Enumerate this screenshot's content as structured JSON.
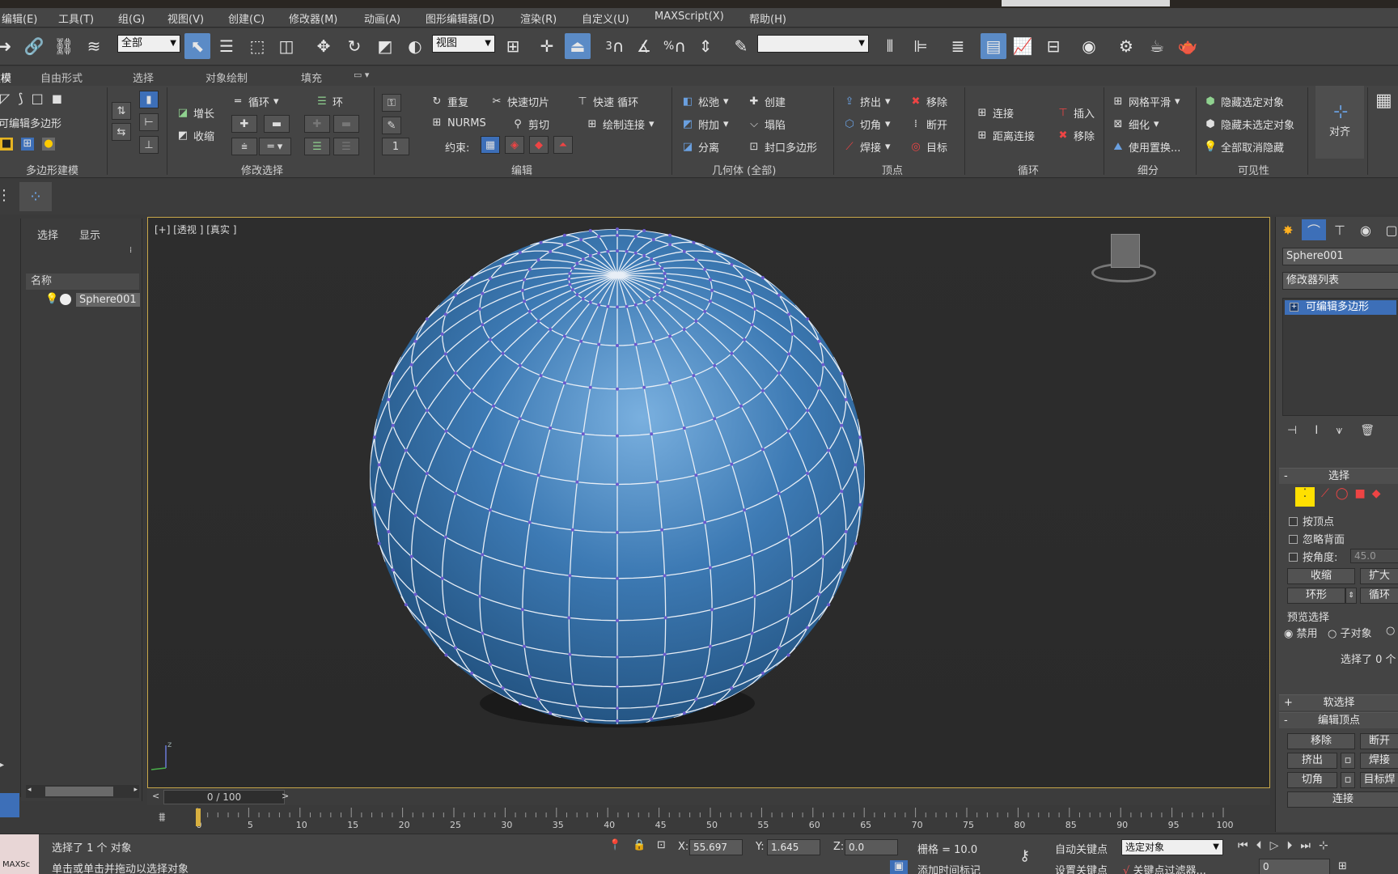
{
  "menu": [
    "编辑(E)",
    "工具(T)",
    "组(G)",
    "视图(V)",
    "创建(C)",
    "修改器(M)",
    "动画(A)",
    "图形编辑器(D)",
    "渲染(R)",
    "自定义(U)",
    "MAXScript(X)",
    "帮助(H)"
  ],
  "toolbar": {
    "filter_value": "全部",
    "refcoord_value": "视图",
    "snap_labels": [
      "3",
      "%"
    ],
    "named_sel_value": ""
  },
  "ribbon": {
    "tabs": [
      "建模",
      "自由形式",
      "选择",
      "对象绘制",
      "填充"
    ],
    "poly_label": "可编辑多边形",
    "group_titles": [
      "多边形建模",
      "修改选择",
      "编辑",
      "几何体 (全部)",
      "顶点",
      "循环",
      "细分",
      "可见性",
      "对齐"
    ],
    "modsel": [
      "增长",
      "收缩",
      "循环",
      "环"
    ],
    "edit_items": [
      "重复",
      "快速切片",
      "快速 循环",
      "NURMS",
      "剪切",
      "绘制连接"
    ],
    "constraint_label": "约束:",
    "spinner_value": "1",
    "geometry": [
      "松弛",
      "创建",
      "附加",
      "塌陷",
      "分离",
      "封口多边形"
    ],
    "vertex": [
      "挤出",
      "移除",
      "切角",
      "断开",
      "焊接",
      "目标"
    ],
    "loop": [
      "连接",
      "插入",
      "距离连接",
      "移除"
    ],
    "subdiv": [
      "网格平滑",
      "细化",
      "使用置换..."
    ],
    "visibility": [
      "隐藏选定对象",
      "隐藏未选定对象",
      "全部取消隐藏"
    ],
    "align_label": "对齐"
  },
  "scene_explorer": {
    "tabs": [
      "选择",
      "显示"
    ],
    "header": "名称",
    "object": "Sphere001"
  },
  "viewport": {
    "label": "[+] [透视 ] [真实 ]",
    "sphere_color": "#2f6fa8",
    "vertex_color": "#6a5acd"
  },
  "timeline": {
    "position": "0 / 100",
    "ticks": [
      "0",
      "5",
      "10",
      "15",
      "20",
      "25",
      "30",
      "35",
      "40",
      "45",
      "50",
      "55",
      "60",
      "65",
      "70",
      "75",
      "80",
      "85",
      "90",
      "95",
      "100"
    ]
  },
  "status": {
    "maxscript": "MAXSc",
    "message1": "选择了 1 个 对象",
    "message2": "单击或单击并拖动以选择对象",
    "x_label": "X:",
    "x": "55.697",
    "y_label": "Y:",
    "y": "1.645",
    "z_label": "Z:",
    "z": "0.0",
    "grid": "栅格 = 10.0",
    "add_time_tag": "添加时间标记",
    "auto_key": "自动关键点",
    "set_key": "设置关键点",
    "selected_value": "选定对象",
    "key_filters": "关键点过滤器...",
    "frame": "0"
  },
  "command_panel": {
    "object_name": "Sphere001",
    "modifier_list": "修改器列表",
    "stack_item": "可编辑多边形",
    "rollout_selection": "选择",
    "by_vertex": "按顶点",
    "ignore_backface": "忽略背面",
    "by_angle": "按角度:",
    "angle_value": "45.0",
    "shrink": "收缩",
    "grow": "扩大",
    "ring": "环形",
    "loop": "循环",
    "preview_selection": "预览选择",
    "disable": "禁用",
    "subobject": "子对象",
    "selected_count": "选择了 0 个",
    "soft_selection": "软选择",
    "edit_vertices": "编辑顶点",
    "remove": "移除",
    "break": "断开",
    "extrude": "挤出",
    "weld": "焊接",
    "chamfer": "切角",
    "target_weld": "目标焊",
    "connect": "连接"
  }
}
